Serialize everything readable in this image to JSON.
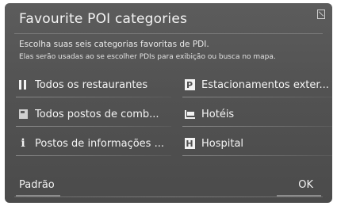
{
  "header": {
    "title": "Favourite POI categories"
  },
  "description": {
    "line1": "Escolha suas seis categorias favoritas de PDI.",
    "line2": "Elas serão usadas ao se escolher PDIs para exibição ou busca no mapa."
  },
  "categories": [
    {
      "icon": "restaurant-icon",
      "label": "Todos os restaurantes"
    },
    {
      "icon": "parking-icon",
      "icon_text": "P",
      "label": "Estacionamentos exter..."
    },
    {
      "icon": "gas-station-icon",
      "label": "Todos postos de comb..."
    },
    {
      "icon": "hotel-icon",
      "label": "Hotéis"
    },
    {
      "icon": "info-icon",
      "icon_text": "i",
      "label": "Postos de informações ..."
    },
    {
      "icon": "hospital-icon",
      "icon_text": "H",
      "label": "Hospital"
    }
  ],
  "footer": {
    "default_label": "Padrão",
    "ok_label": "OK"
  }
}
